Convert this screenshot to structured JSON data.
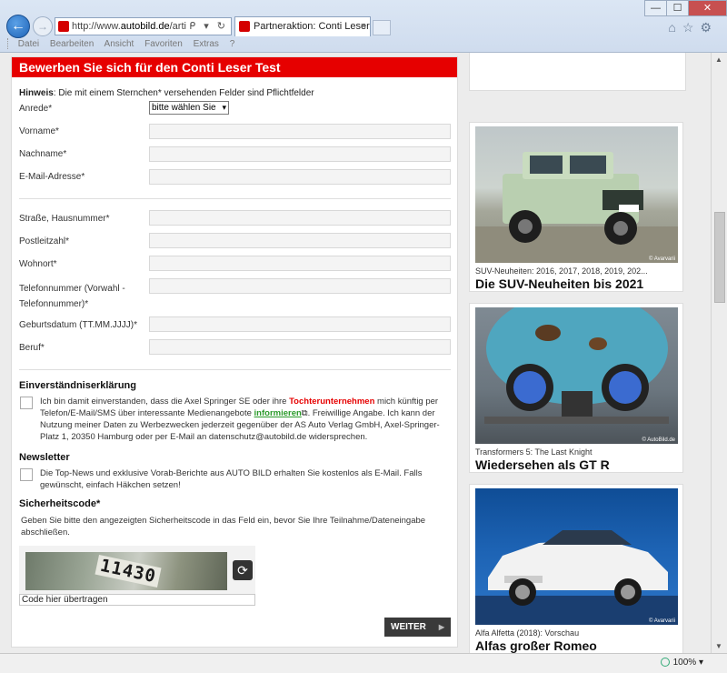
{
  "browser": {
    "address_prefix": "http://www.",
    "address_domain": "autobild.de",
    "address_suffix": "/artikel/par",
    "address_tools": "ᑭ ▾ ↻",
    "tab_title": "Partneraktion: Conti Leser T...",
    "tab_close": "×",
    "win_minimize": "—",
    "win_maximize": "☐",
    "win_close": "✕",
    "menu": [
      "Datei",
      "Bearbeiten",
      "Ansicht",
      "Favoriten",
      "Extras",
      "?"
    ],
    "zoom": "100%"
  },
  "form": {
    "header": "Bewerben Sie sich für den Conti Leser Test",
    "hint_bold": "Hinweis",
    "hint_text": ": Die mit einem Sternchen* versehenden Felder sind Pflichtfelder",
    "anrede_label": "Anrede*",
    "anrede_value": "bitte wählen Sie",
    "vorname_label": "Vorname*",
    "nachname_label": "Nachname*",
    "email_label": "E-Mail-Adresse*",
    "strasse_label": "Straße, Hausnummer*",
    "plz_label": "Postleitzahl*",
    "wohnort_label": "Wohnort*",
    "telefon_label_1": "Telefonnummer (Vorwahl -",
    "telefon_label_2": "Telefonnummer)*",
    "geburtsdatum_label": "Geburtsdatum (TT.MM.JJJJ)*",
    "beruf_label": "Beruf*",
    "consent_title": "Einverständniserklärung",
    "consent_text_1": "Ich bin damit einverstanden, dass die Axel Springer SE oder ihre ",
    "consent_link_red": "Tochterunternehmen",
    "consent_text_2": " mich künftig per Telefon/E-Mail/SMS über interessante Medienangebote ",
    "consent_link_green": "informieren",
    "consent_text_3": ". Freiwillige Angabe. Ich kann der Nutzung meiner Daten zu Werbezwecken jederzeit gegenüber der AS Auto Verlag GmbH, Axel-Springer-Platz 1, 20350 Hamburg oder per E-Mail an datenschutz@autobild.de widersprechen.",
    "newsletter_title": "Newsletter",
    "newsletter_text": "Die Top-News und exklusive Vorab-Berichte aus AUTO BILD erhalten Sie kostenlos als E-Mail. Falls gewünscht, einfach Häkchen setzen!",
    "security_title": "Sicherheitscode*",
    "security_text": "Geben Sie bitte den angezeigten Sicherheitscode in das Feld ein, bevor Sie Ihre Teilnahme/Dateneingabe abschließen.",
    "captcha_code": "11430",
    "captcha_placeholder": "Code hier übertragen",
    "submit_label": "WEITER"
  },
  "teasers": [
    {
      "kicker": "SUV-Neuheiten: 2016, 2017, 2018, 2019, 202...",
      "title": "Die SUV-Neuheiten bis 2021",
      "copyright": "© Avarvarii"
    },
    {
      "kicker": "Transformers 5: The Last Knight",
      "title": "Wiedersehen als GT R",
      "copyright": "© AutoBild.de"
    },
    {
      "kicker": "Alfa Alfetta (2018): Vorschau",
      "title": "Alfas großer Romeo",
      "copyright": "© Avarvarii"
    }
  ]
}
